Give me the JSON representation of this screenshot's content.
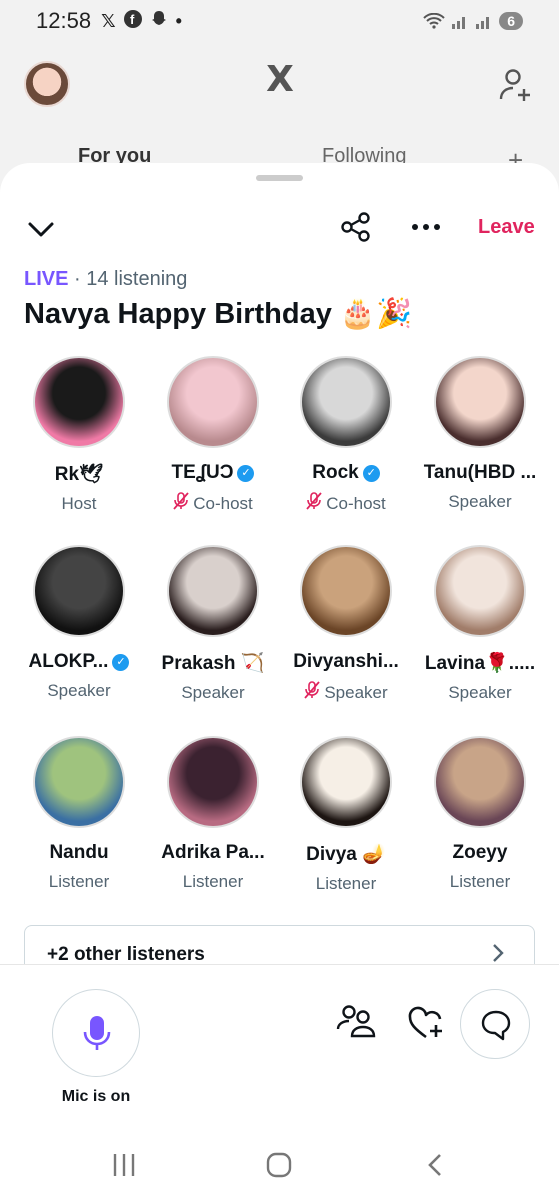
{
  "status_bar": {
    "time": "12:58",
    "app_icons": [
      "x-icon",
      "facebook-icon",
      "snapchat-icon"
    ],
    "dot": "•",
    "battery": "6"
  },
  "app_header": {
    "logo": "X",
    "tabs": [
      "For you",
      "Following",
      "+"
    ]
  },
  "space": {
    "leave_label": "Leave",
    "live_label": "LIVE",
    "listening": "· 14 listening",
    "title": "Navya Happy Birthday 🎂🎉"
  },
  "participants": [
    {
      "name": "Rk🕊",
      "role": "Host",
      "verified": false,
      "muted": false,
      "colors": [
        "#1a1a1a",
        "#f07aa6"
      ]
    },
    {
      "name": "TEʆUƆ",
      "role": "Co-host",
      "verified": true,
      "muted": true,
      "colors": [
        "#f2c7cf",
        "#b88a8e"
      ]
    },
    {
      "name": "Rock",
      "role": "Co-host",
      "verified": true,
      "muted": true,
      "colors": [
        "#d8d8d8",
        "#3b3b3b"
      ]
    },
    {
      "name": "Tanu(HBD ...",
      "role": "Speaker",
      "verified": false,
      "muted": false,
      "colors": [
        "#f3d6cb",
        "#4a2e2e"
      ]
    },
    {
      "name": "ALOKP...",
      "role": "Speaker",
      "verified": true,
      "muted": false,
      "colors": [
        "#444",
        "#111"
      ]
    },
    {
      "name": "Prakash 🏹",
      "role": "Speaker",
      "verified": false,
      "muted": false,
      "colors": [
        "#d9d0cc",
        "#2a1e1e"
      ]
    },
    {
      "name": "Divyanshi...",
      "role": "Speaker",
      "verified": false,
      "muted": true,
      "colors": [
        "#caa27c",
        "#6b4527"
      ]
    },
    {
      "name": "Lavina🌹.....",
      "role": "Speaker",
      "verified": false,
      "muted": false,
      "colors": [
        "#f1e4dc",
        "#a17d6a"
      ]
    },
    {
      "name": "Nandu",
      "role": "Listener",
      "verified": false,
      "muted": false,
      "colors": [
        "#9fc37e",
        "#3a6fa3"
      ]
    },
    {
      "name": "Adrika Pa...",
      "role": "Listener",
      "verified": false,
      "muted": false,
      "colors": [
        "#3b2230",
        "#b86b82"
      ]
    },
    {
      "name": "Divya 🪔",
      "role": "Listener",
      "verified": false,
      "muted": false,
      "colors": [
        "#f6efe6",
        "#1d1512"
      ]
    },
    {
      "name": "Zoeyy",
      "role": "Listener",
      "verified": false,
      "muted": false,
      "colors": [
        "#c8a488",
        "#6a4656"
      ]
    }
  ],
  "others": {
    "label": "+2 other listeners"
  },
  "bottom": {
    "mic_label": "Mic is on",
    "accent": "#7856ff"
  }
}
